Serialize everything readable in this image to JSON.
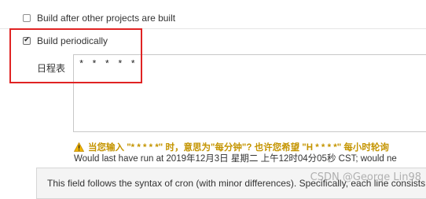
{
  "build_after": {
    "label": "Build after other projects are built",
    "checked": false
  },
  "build_periodically": {
    "label": "Build periodically",
    "checked": true,
    "check_glyph": "✔"
  },
  "schedule": {
    "label": "日程表",
    "value": "* * * * *"
  },
  "warning": {
    "icon": "warning-triangle-icon",
    "text": "当您输入 \"* * * * *\" 时，意思为\"每分钟\"? 也许您希望 \"H * * * *\" 每小时轮询",
    "color": "#c49400"
  },
  "last_run": {
    "text": "Would last have run at 2019年12月3日 星期二 上午12时04分05秒 CST; would ne"
  },
  "help": {
    "text": "This field follows the syntax of cron (with minor differences). Specifically, each line consists"
  },
  "watermark": {
    "text": "CSDN @George Lin98"
  },
  "colors": {
    "highlight_border": "#e02323",
    "warning_text": "#c49400"
  }
}
